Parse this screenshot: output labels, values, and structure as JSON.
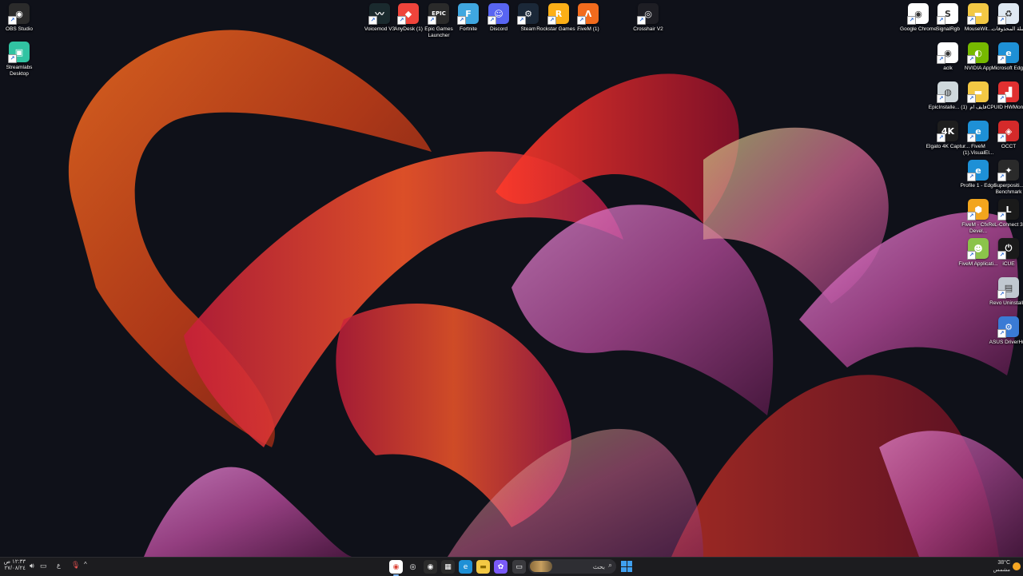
{
  "desktop": {
    "left_icons": [
      {
        "label": "OBS Studio",
        "icon": "obs-icon",
        "bg": "#2b2b2b",
        "glyph": "◉"
      },
      {
        "label": "Streamlabs Desktop",
        "icon": "streamlabs-icon",
        "bg": "#31c3a2",
        "glyph": "▣"
      }
    ],
    "top_icons": [
      {
        "label": "Voicemod V3",
        "icon": "voicemod-icon",
        "bg": "#1a2a2e",
        "glyph": "〰"
      },
      {
        "label": "AnyDesk (1)",
        "icon": "anydesk-icon",
        "bg": "#ef443b",
        "glyph": "◆"
      },
      {
        "label": "Epic Games Launcher",
        "icon": "epic-games-icon",
        "bg": "#2a2a2a",
        "glyph": "EPIC"
      },
      {
        "label": "Fortnite",
        "icon": "fortnite-icon",
        "bg": "#3fa7e0",
        "glyph": "F"
      },
      {
        "label": "Discord",
        "icon": "discord-icon",
        "bg": "#5865f2",
        "glyph": "☺"
      },
      {
        "label": "Steam",
        "icon": "steam-icon",
        "bg": "#1b2838",
        "glyph": "⚙"
      },
      {
        "label": "Rockstar Games ...",
        "icon": "rockstar-icon",
        "bg": "#fcaf17",
        "glyph": "R"
      },
      {
        "label": "FiveM (1)",
        "icon": "fivem-icon",
        "bg": "#f26b1d",
        "glyph": "Λ"
      },
      {
        "label": "Crosshair V2",
        "icon": "crosshair-icon",
        "bg": "#1e1e24",
        "glyph": "◎"
      }
    ],
    "right_icons": [
      {
        "label": "Google Chrome",
        "icon": "chrome-icon",
        "bg": "#ffffff",
        "glyph": "◉",
        "col": 0,
        "row": 0
      },
      {
        "label": "SignalRgb",
        "icon": "signalrgb-icon",
        "bg": "#ffffff",
        "glyph": "S",
        "col": 1,
        "row": 0
      },
      {
        "label": "MouseWit...",
        "icon": "folder-icon",
        "bg": "#f3c844",
        "glyph": "▬",
        "col": 2,
        "row": 0
      },
      {
        "label": "سلة المحذوفات",
        "icon": "recycle-bin-icon",
        "bg": "#dfe9f3",
        "glyph": "♻",
        "col": 3,
        "row": 0
      },
      {
        "label": "aclk",
        "icon": "chrome-shortcut-icon",
        "bg": "#ffffff",
        "glyph": "◉",
        "col": 1,
        "row": 1
      },
      {
        "label": "NVIDIA App",
        "icon": "nvidia-icon",
        "bg": "#76b900",
        "glyph": "◐",
        "col": 2,
        "row": 1
      },
      {
        "label": "Microsoft Edge",
        "icon": "edge-icon",
        "bg": "#1e90d6",
        "glyph": "e",
        "col": 3,
        "row": 1
      },
      {
        "label": "EpicInstalle... (1)",
        "icon": "installer-icon",
        "bg": "#cfd8dc",
        "glyph": "◍",
        "col": 1,
        "row": 2
      },
      {
        "label": "فايف ام",
        "icon": "folder-icon",
        "bg": "#f3c844",
        "glyph": "▬",
        "col": 2,
        "row": 2
      },
      {
        "label": "CPUID HWMonitor",
        "icon": "hwmonitor-icon",
        "bg": "#e03030",
        "glyph": "▟",
        "col": 3,
        "row": 2
      },
      {
        "label": "Elgato 4K Captur...",
        "icon": "elgato-icon",
        "bg": "#1e1e1e",
        "glyph": "4K",
        "col": 1,
        "row": 3
      },
      {
        "label": "FiveM (1).VisualEl...",
        "icon": "edge-file-icon",
        "bg": "#1e90d6",
        "glyph": "e",
        "col": 2,
        "row": 3
      },
      {
        "label": "OCCT",
        "icon": "occt-icon",
        "bg": "#d42a2a",
        "glyph": "◈",
        "col": 3,
        "row": 3
      },
      {
        "label": "Profile 1 - Edge",
        "icon": "edge-profile-icon",
        "bg": "#1e90d6",
        "glyph": "e",
        "col": 2,
        "row": 4
      },
      {
        "label": "Superpositi... Benchmark",
        "icon": "superposition-icon",
        "bg": "#2a2a2a",
        "glyph": "✦",
        "col": 3,
        "row": 4
      },
      {
        "label": "FiveM - CfxRe Devel...",
        "icon": "cfx-icon",
        "bg": "#f2a51d",
        "glyph": "⬢",
        "col": 2,
        "row": 5
      },
      {
        "label": "L-Connect 3",
        "icon": "lconnect-icon",
        "bg": "#1a1a1a",
        "glyph": "L",
        "col": 3,
        "row": 5
      },
      {
        "label": "FiveM Applicati...",
        "icon": "fivem-app-icon",
        "bg": "#8bc34a",
        "glyph": "☻",
        "col": 2,
        "row": 6
      },
      {
        "label": "iCUE",
        "icon": "icue-icon",
        "bg": "#1a1a1a",
        "glyph": "⏻",
        "col": 3,
        "row": 6
      },
      {
        "label": "Revo Uninstaller",
        "icon": "revo-icon",
        "bg": "#c0c8d0",
        "glyph": "▤",
        "col": 3,
        "row": 7
      },
      {
        "label": "ASUS DriverHub",
        "icon": "asus-driverhub-icon",
        "bg": "#3a7bd5",
        "glyph": "⚙",
        "col": 3,
        "row": 8
      }
    ]
  },
  "taskbar": {
    "apps": [
      {
        "name": "chrome-taskbar-icon",
        "bg": "#ffffff",
        "glyph": "◉",
        "color": "#db4437"
      },
      {
        "name": "crosshair-taskbar-icon",
        "bg": "#1c1c1f",
        "glyph": "◎",
        "color": "#ffffff"
      },
      {
        "name": "obs-taskbar-icon",
        "bg": "#2b2b2b",
        "glyph": "◉",
        "color": "#ffffff"
      },
      {
        "name": "store-taskbar-icon",
        "bg": "#2b2b2b",
        "glyph": "▦",
        "color": "#ffffff"
      },
      {
        "name": "edge-taskbar-icon",
        "bg": "#1e90d6",
        "glyph": "e",
        "color": "#ffffff"
      },
      {
        "name": "file-explorer-taskbar-icon",
        "bg": "#f3c844",
        "glyph": "▬",
        "color": "#8a6a00"
      },
      {
        "name": "copilot-taskbar-icon",
        "bg": "#7a5af8",
        "glyph": "✿",
        "color": "#ffffff"
      },
      {
        "name": "task-view-taskbar-icon",
        "bg": "#3a3a3e",
        "glyph": "▭",
        "color": "#ffffff"
      }
    ],
    "search_label": "بحث",
    "weather": {
      "temp": "38°C",
      "condition": "مشمس"
    },
    "clock": {
      "time": "١٢:٣٣ ص",
      "date": "٢٧/٠٨/٢٤"
    },
    "language": "ع",
    "tray_chevron": "^"
  }
}
